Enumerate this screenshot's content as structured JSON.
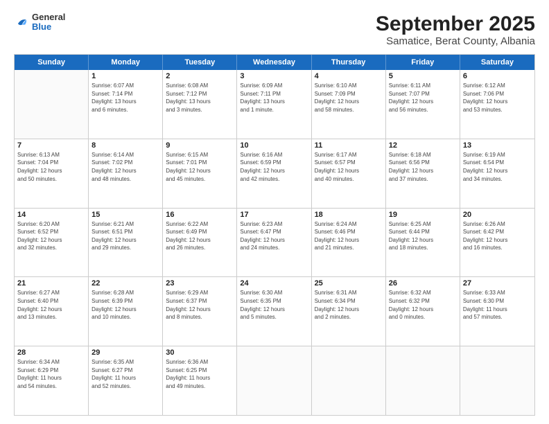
{
  "header": {
    "logo": {
      "line1": "General",
      "line2": "Blue"
    },
    "title": "September 2025",
    "subtitle": "Samatice, Berat County, Albania"
  },
  "weekdays": [
    "Sunday",
    "Monday",
    "Tuesday",
    "Wednesday",
    "Thursday",
    "Friday",
    "Saturday"
  ],
  "rows": [
    [
      {
        "day": "",
        "info": ""
      },
      {
        "day": "1",
        "info": "Sunrise: 6:07 AM\nSunset: 7:14 PM\nDaylight: 13 hours\nand 6 minutes."
      },
      {
        "day": "2",
        "info": "Sunrise: 6:08 AM\nSunset: 7:12 PM\nDaylight: 13 hours\nand 3 minutes."
      },
      {
        "day": "3",
        "info": "Sunrise: 6:09 AM\nSunset: 7:11 PM\nDaylight: 13 hours\nand 1 minute."
      },
      {
        "day": "4",
        "info": "Sunrise: 6:10 AM\nSunset: 7:09 PM\nDaylight: 12 hours\nand 58 minutes."
      },
      {
        "day": "5",
        "info": "Sunrise: 6:11 AM\nSunset: 7:07 PM\nDaylight: 12 hours\nand 56 minutes."
      },
      {
        "day": "6",
        "info": "Sunrise: 6:12 AM\nSunset: 7:06 PM\nDaylight: 12 hours\nand 53 minutes."
      }
    ],
    [
      {
        "day": "7",
        "info": "Sunrise: 6:13 AM\nSunset: 7:04 PM\nDaylight: 12 hours\nand 50 minutes."
      },
      {
        "day": "8",
        "info": "Sunrise: 6:14 AM\nSunset: 7:02 PM\nDaylight: 12 hours\nand 48 minutes."
      },
      {
        "day": "9",
        "info": "Sunrise: 6:15 AM\nSunset: 7:01 PM\nDaylight: 12 hours\nand 45 minutes."
      },
      {
        "day": "10",
        "info": "Sunrise: 6:16 AM\nSunset: 6:59 PM\nDaylight: 12 hours\nand 42 minutes."
      },
      {
        "day": "11",
        "info": "Sunrise: 6:17 AM\nSunset: 6:57 PM\nDaylight: 12 hours\nand 40 minutes."
      },
      {
        "day": "12",
        "info": "Sunrise: 6:18 AM\nSunset: 6:56 PM\nDaylight: 12 hours\nand 37 minutes."
      },
      {
        "day": "13",
        "info": "Sunrise: 6:19 AM\nSunset: 6:54 PM\nDaylight: 12 hours\nand 34 minutes."
      }
    ],
    [
      {
        "day": "14",
        "info": "Sunrise: 6:20 AM\nSunset: 6:52 PM\nDaylight: 12 hours\nand 32 minutes."
      },
      {
        "day": "15",
        "info": "Sunrise: 6:21 AM\nSunset: 6:51 PM\nDaylight: 12 hours\nand 29 minutes."
      },
      {
        "day": "16",
        "info": "Sunrise: 6:22 AM\nSunset: 6:49 PM\nDaylight: 12 hours\nand 26 minutes."
      },
      {
        "day": "17",
        "info": "Sunrise: 6:23 AM\nSunset: 6:47 PM\nDaylight: 12 hours\nand 24 minutes."
      },
      {
        "day": "18",
        "info": "Sunrise: 6:24 AM\nSunset: 6:46 PM\nDaylight: 12 hours\nand 21 minutes."
      },
      {
        "day": "19",
        "info": "Sunrise: 6:25 AM\nSunset: 6:44 PM\nDaylight: 12 hours\nand 18 minutes."
      },
      {
        "day": "20",
        "info": "Sunrise: 6:26 AM\nSunset: 6:42 PM\nDaylight: 12 hours\nand 16 minutes."
      }
    ],
    [
      {
        "day": "21",
        "info": "Sunrise: 6:27 AM\nSunset: 6:40 PM\nDaylight: 12 hours\nand 13 minutes."
      },
      {
        "day": "22",
        "info": "Sunrise: 6:28 AM\nSunset: 6:39 PM\nDaylight: 12 hours\nand 10 minutes."
      },
      {
        "day": "23",
        "info": "Sunrise: 6:29 AM\nSunset: 6:37 PM\nDaylight: 12 hours\nand 8 minutes."
      },
      {
        "day": "24",
        "info": "Sunrise: 6:30 AM\nSunset: 6:35 PM\nDaylight: 12 hours\nand 5 minutes."
      },
      {
        "day": "25",
        "info": "Sunrise: 6:31 AM\nSunset: 6:34 PM\nDaylight: 12 hours\nand 2 minutes."
      },
      {
        "day": "26",
        "info": "Sunrise: 6:32 AM\nSunset: 6:32 PM\nDaylight: 12 hours\nand 0 minutes."
      },
      {
        "day": "27",
        "info": "Sunrise: 6:33 AM\nSunset: 6:30 PM\nDaylight: 11 hours\nand 57 minutes."
      }
    ],
    [
      {
        "day": "28",
        "info": "Sunrise: 6:34 AM\nSunset: 6:29 PM\nDaylight: 11 hours\nand 54 minutes."
      },
      {
        "day": "29",
        "info": "Sunrise: 6:35 AM\nSunset: 6:27 PM\nDaylight: 11 hours\nand 52 minutes."
      },
      {
        "day": "30",
        "info": "Sunrise: 6:36 AM\nSunset: 6:25 PM\nDaylight: 11 hours\nand 49 minutes."
      },
      {
        "day": "",
        "info": ""
      },
      {
        "day": "",
        "info": ""
      },
      {
        "day": "",
        "info": ""
      },
      {
        "day": "",
        "info": ""
      }
    ]
  ]
}
